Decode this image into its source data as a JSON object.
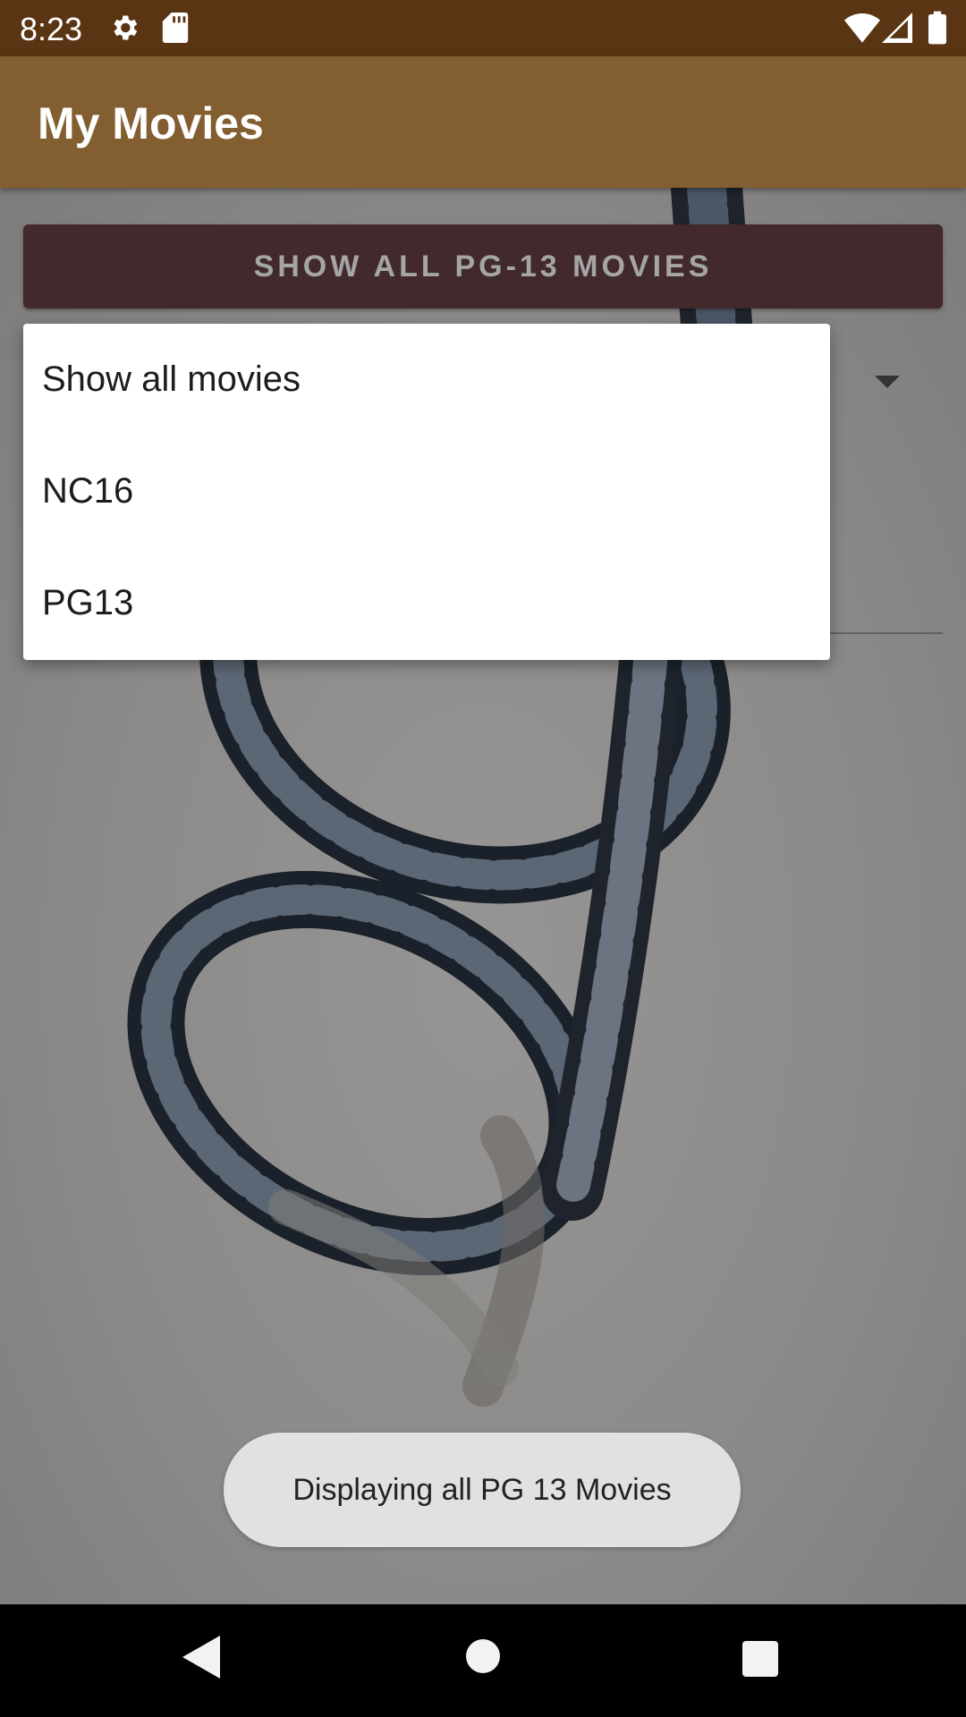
{
  "status_bar": {
    "time": "8:23",
    "icons": [
      "gear-icon",
      "sd-card-icon",
      "wifi-icon",
      "cell-signal-icon",
      "battery-icon"
    ],
    "background": "#5a3514"
  },
  "app_bar": {
    "title": "My Movies",
    "background": "#835e30"
  },
  "main": {
    "pg13_button_label": "SHOW ALL PG-13 MOVIES",
    "button_color": "#5d3c3f"
  },
  "dropdown": {
    "items": [
      {
        "label": "Show all movies"
      },
      {
        "label": "NC16"
      },
      {
        "label": "PG13"
      }
    ]
  },
  "toast": {
    "message": "Displaying all PG 13 Movies"
  },
  "nav_bar": {
    "icons": [
      "back-icon",
      "home-icon",
      "recents-icon"
    ]
  }
}
